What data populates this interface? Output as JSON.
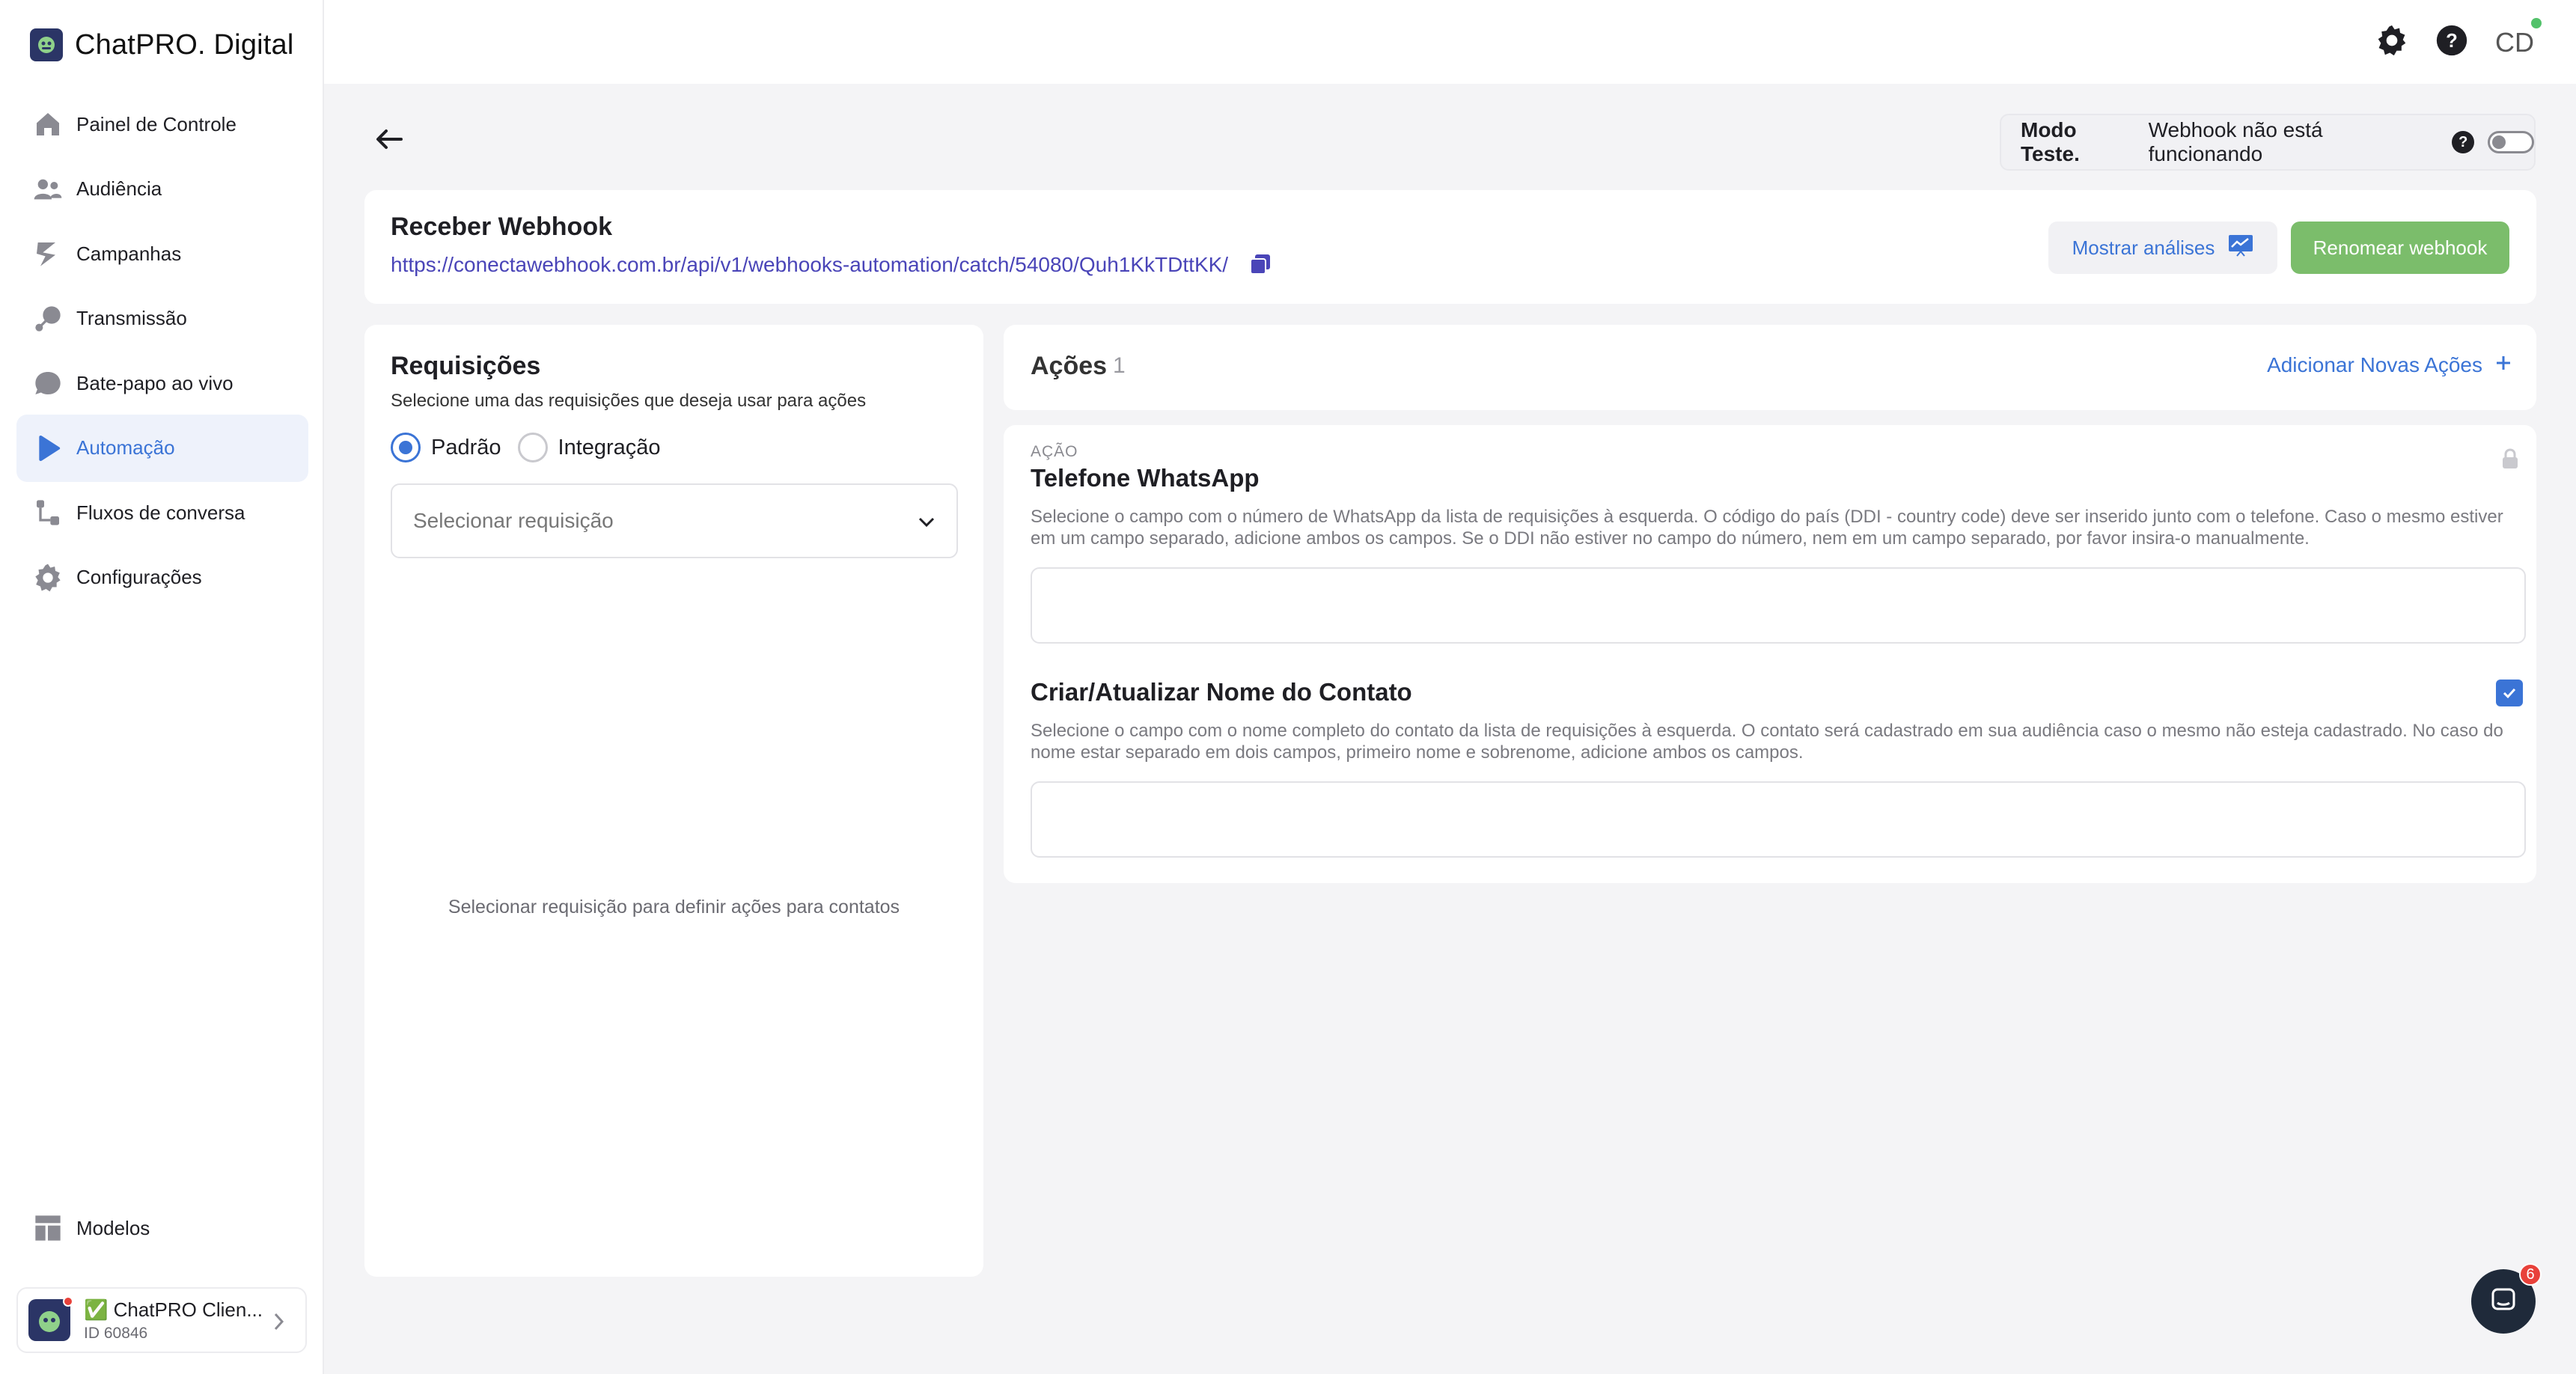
{
  "brand": {
    "name": "ChatPRO. Digital"
  },
  "sidebar": {
    "items": [
      {
        "label": "Painel de Controle",
        "icon": "home-icon"
      },
      {
        "label": "Audiência",
        "icon": "users-icon"
      },
      {
        "label": "Campanhas",
        "icon": "campaign-icon"
      },
      {
        "label": "Transmissão",
        "icon": "broadcast-icon"
      },
      {
        "label": "Bate-papo ao vivo",
        "icon": "chat-bubble-icon"
      },
      {
        "label": "Automação",
        "icon": "automation-icon",
        "active": true
      },
      {
        "label": "Fluxos de conversa",
        "icon": "flow-icon"
      },
      {
        "label": "Configurações",
        "icon": "gear-icon"
      }
    ],
    "bottom_item": {
      "label": "Modelos",
      "icon": "templates-icon"
    },
    "account": {
      "name": "✅ ChatPRO Clien...",
      "id": "ID 60846"
    }
  },
  "topbar": {
    "avatar_initials": "CD"
  },
  "test_mode": {
    "label": "Modo Teste.",
    "status": "Webhook não está funcionando",
    "help": "?"
  },
  "webhook": {
    "title": "Receber Webhook",
    "url": "https://conectawebhook.com.br/api/v1/webhooks-automation/catch/54080/Quh1KkTDttKK/",
    "analytics_button": "Mostrar análises",
    "rename_button": "Renomear webhook"
  },
  "requests": {
    "title": "Requisições",
    "subtitle": "Selecione uma das requisições que deseja usar para ações",
    "radio_default": "Padrão",
    "radio_integration": "Integração",
    "select_placeholder": "Selecionar requisição",
    "empty_text": "Selecionar requisição para definir ações para contatos"
  },
  "actions": {
    "title": "Ações",
    "count": "1",
    "add_label": "Adicionar Novas Ações",
    "kicker": "AÇÃO",
    "phone_title": "Telefone WhatsApp",
    "phone_desc": "Selecione o campo com o número de WhatsApp da lista de requisições à esquerda. O código do país (DDI - country code) deve ser inserido junto com o telefone. Caso o mesmo estiver em um campo separado, adicione ambos os campos. Se o DDI não estiver no campo do número, nem em um campo separado, por favor insira-o manualmente.",
    "name_title": "Criar/Atualizar Nome do Contato",
    "name_desc": "Selecione o campo com o nome completo do contato da lista de requisições à esquerda. O contato será cadastrado em sua audiência caso o mesmo não esteja cadastrado. No caso do nome estar separado em dois campos, primeiro nome e sobrenome, adicione ambos os campos."
  },
  "chat_widget": {
    "badge": "6"
  },
  "colors": {
    "accent": "#3b74d6",
    "success": "#7bbd6b",
    "link": "#4a45b8"
  }
}
